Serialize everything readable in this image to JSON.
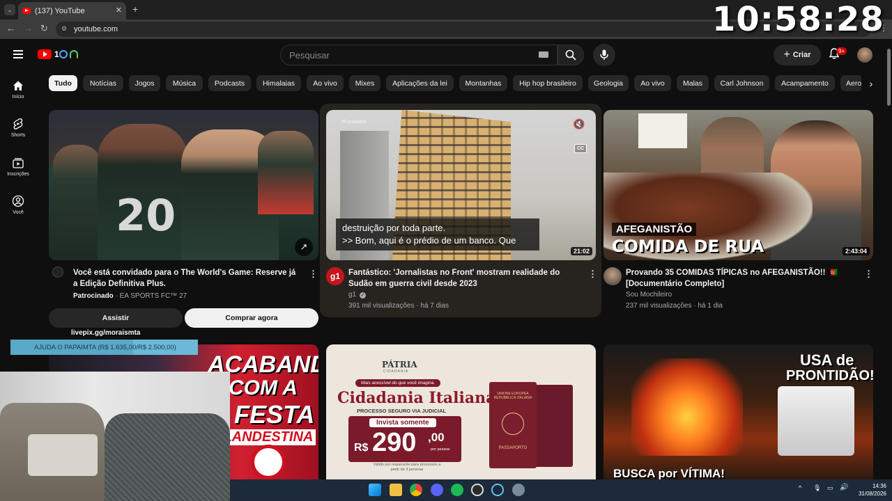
{
  "browser": {
    "tab_title": "(137) YouTube",
    "url": "youtube.com"
  },
  "overlay": {
    "clock": "10:58:28",
    "livepix": "livepix.gg/moraismta",
    "donation": "AJUDA O PAPAIMTA (R$ 1.635,00/R$ 2.500,00)",
    "donation_progress": 0.654
  },
  "header": {
    "search_placeholder": "Pesquisar",
    "create_label": "Criar",
    "notifications_badge": "9+"
  },
  "sidebar": {
    "items": [
      {
        "label": "Início",
        "icon": "home-icon"
      },
      {
        "label": "Shorts",
        "icon": "shorts-icon"
      },
      {
        "label": "Inscrições",
        "icon": "subscriptions-icon"
      },
      {
        "label": "Você",
        "icon": "you-icon"
      }
    ]
  },
  "chips": [
    "Tudo",
    "Notícias",
    "Jogos",
    "Música",
    "Podcasts",
    "Himalaias",
    "Ao vivo",
    "Mixes",
    "Aplicações da lei",
    "Montanhas",
    "Hip hop brasileiro",
    "Geologia",
    "Ao vivo",
    "Malas",
    "Carl Johnson",
    "Acampamento",
    "Aero"
  ],
  "videos": [
    {
      "title": "Você está convidado para o The World's Game: Reserve já a Edição Definitiva Plus.",
      "sponsored": "Patrocinado",
      "channel": "· EA SPORTS FC™ 27",
      "buttons": [
        "Assistir",
        "Comprar agora"
      ],
      "thumb_text": "20"
    },
    {
      "title": "Fantástico: 'Jornalistas no Front' mostram realidade do Sudão em guerra civil desde 2023",
      "channel": "g1",
      "meta": "391 mil visualizações · há 7 dias",
      "duration": "21:02",
      "caption_lines": [
        "destruição por toda parte.",
        ">> Bom, aqui é o prédio de um banco. Que"
      ],
      "watermark": "#Fantástico",
      "cc": "CC",
      "avatar_text": "g1"
    },
    {
      "title": "Provando 35 COMIDAS TÍPICAS no AFEGANISTÃO!! 🇦🇫 [Documentário Completo]",
      "channel": "Sou Mochileiro",
      "meta": "237 mil visualizações · há 1 dia",
      "duration": "2:43:04",
      "thumb_labels": [
        "AFEGANISTÃO",
        "COMIDA DE RUA"
      ]
    }
  ],
  "row2": {
    "thumb1": [
      "ACABANDO",
      "COM A",
      "FESTA",
      "CLANDESTINA"
    ],
    "thumb2": {
      "brand": "PÁTRIA",
      "brand_sub": "CIDADANIA",
      "tagline": "Mais acessível do que você imagina.",
      "headline": "Cidadania Italiana",
      "sub": "PROCESSO SEGURO VIA JUDICIAL",
      "invest": "Invista somente",
      "price_prefix": "R$",
      "price": "290",
      "price_cents": ",00",
      "per": "por pessoa",
      "note": "Válido por requerente para processos a partir de 3 pessoas",
      "passport_top": "UNIONE EUROPEA REPUBBLICA ITALIANA",
      "passport_label": "PASSAPORTO"
    },
    "thumb3": [
      "USA de",
      "PRONTIDÃO!",
      "BUSCA por VÍTIMA!"
    ]
  },
  "taskbar": {
    "time": "14:36",
    "date": "31/08/2026"
  }
}
